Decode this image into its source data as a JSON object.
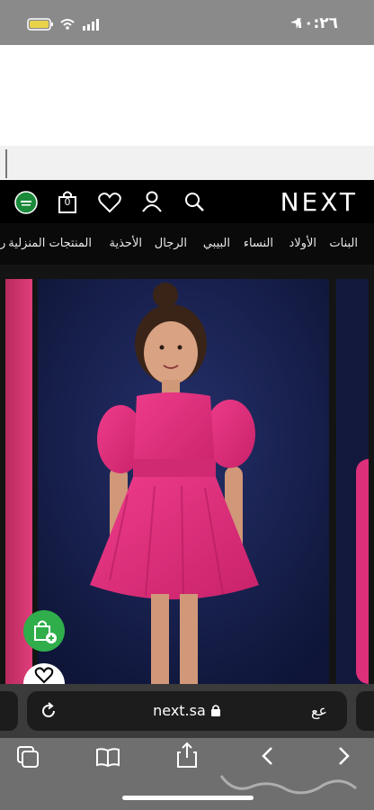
{
  "status": {
    "time": "١٠:٢٦"
  },
  "header": {
    "logo": "NEXT",
    "bag_count": "0"
  },
  "nav": {
    "items": [
      "البنات",
      "الأولاد",
      "النساء",
      "البيبي",
      "الرجال",
      "الأحذية",
      "المنتجات المنزلية",
      "ر"
    ]
  },
  "browser": {
    "url": "next.sa",
    "text_size_label": "عع"
  },
  "watermark": "حراج",
  "colors": {
    "header_bg": "#000000",
    "dress_pink": "#e0317a",
    "photo_bg": "#1a2450",
    "cart_green": "#2fae4b"
  },
  "icons": [
    "location-arrow-icon",
    "battery-icon",
    "wifi-icon",
    "signal-icon",
    "saudi-flag-icon",
    "bag-icon",
    "heart-icon",
    "user-icon",
    "search-icon",
    "add-to-bag-icon",
    "reload-icon",
    "lock-icon",
    "tabs-icon",
    "bookmarks-icon",
    "share-icon",
    "back-icon",
    "forward-icon"
  ]
}
